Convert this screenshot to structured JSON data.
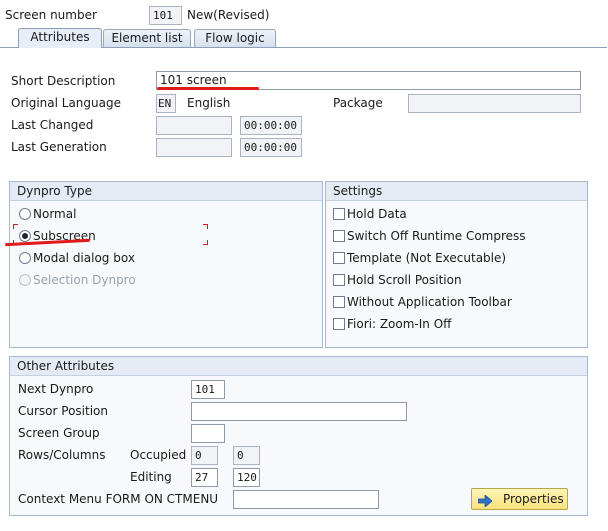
{
  "header": {
    "screen_number_label": "Screen number",
    "screen_number_value": "101",
    "status": "New(Revised)"
  },
  "tabs": [
    {
      "label": "Attributes",
      "active": true
    },
    {
      "label": "Element list",
      "active": false
    },
    {
      "label": "Flow logic",
      "active": false
    }
  ],
  "attributes": {
    "short_description_label": "Short Description",
    "short_description_value": "101 screen",
    "original_language_label": "Original Language",
    "language_code": "EN",
    "language_name": "English",
    "package_label": "Package",
    "package_value": "",
    "last_changed_label": "Last Changed",
    "last_changed_date": "",
    "last_changed_time": "00:00:00",
    "last_generation_label": "Last Generation",
    "last_generation_date": "",
    "last_generation_time": "00:00:00"
  },
  "dynpro_type": {
    "title": "Dynpro Type",
    "options": [
      {
        "label": "Normal",
        "selected": false,
        "enabled": true
      },
      {
        "label": "Subscreen",
        "selected": true,
        "enabled": true
      },
      {
        "label": "Modal dialog box",
        "selected": false,
        "enabled": true
      },
      {
        "label": "Selection Dynpro",
        "selected": false,
        "enabled": false
      }
    ]
  },
  "settings": {
    "title": "Settings",
    "options": [
      {
        "label": "Hold Data",
        "checked": false
      },
      {
        "label": "Switch Off Runtime Compress",
        "checked": false
      },
      {
        "label": "Template (Not Executable)",
        "checked": false
      },
      {
        "label": "Hold Scroll Position",
        "checked": false
      },
      {
        "label": "Without Application Toolbar",
        "checked": false
      },
      {
        "label": "Fiori: Zoom-In Off",
        "checked": false
      }
    ]
  },
  "other_attributes": {
    "title": "Other Attributes",
    "next_dynpro_label": "Next Dynpro",
    "next_dynpro_value": "101",
    "cursor_position_label": "Cursor Position",
    "cursor_position_value": "",
    "screen_group_label": "Screen Group",
    "screen_group_value": "",
    "rows_columns_label": "Rows/Columns",
    "occupied_label": "Occupied",
    "occupied_rows": "0",
    "occupied_cols": "0",
    "editing_label": "Editing",
    "editing_rows": "27",
    "editing_cols": "120",
    "context_menu_label": "Context Menu FORM ON CTMENU",
    "context_menu_value": "",
    "properties_button": "Properties"
  },
  "colors": {
    "annotation_red": "#e01a1a",
    "tab_border": "#8c9fb9",
    "group_header": "#e4ebf4",
    "button_yellow": "#f7e27a"
  }
}
